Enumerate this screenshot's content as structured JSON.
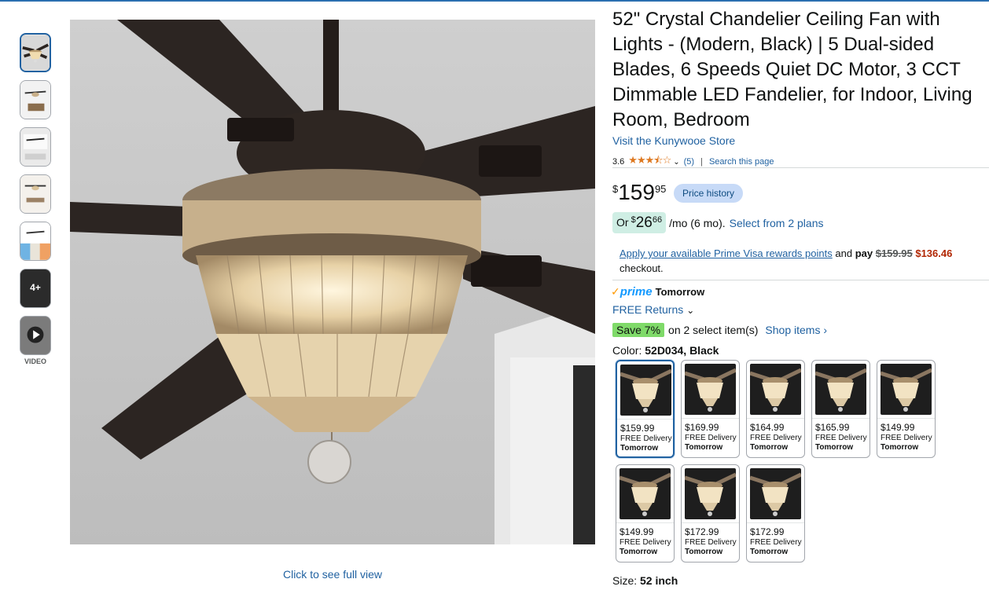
{
  "thumbnails": {
    "more_label": "4+",
    "video_label": "VIDEO"
  },
  "main_image": {
    "caption": "Click to see full view"
  },
  "product": {
    "title": "52\" Crystal Chandelier Ceiling Fan with Lights - (Modern, Black) | 5 Dual-sided Blades, 6 Speeds Quiet DC Motor, 3 CCT Dimmable LED Fandelier, for Indoor, Living Room, Bedroom",
    "store_link": "Visit the Kunywooe Store",
    "rating": "3.6",
    "stars": "★★★⯪☆",
    "review_count": "(5)",
    "search_page": "Search this page"
  },
  "price": {
    "symbol": "$",
    "whole": "159",
    "fraction": "95",
    "history_label": "Price history"
  },
  "monthly": {
    "prefix": "Or",
    "symbol": "$",
    "whole": "26",
    "fraction": "66",
    "suffix": "/mo (6 mo).",
    "plans_link": "Select from 2 plans"
  },
  "visa": {
    "link": "Apply your available Prime Visa rewards points",
    "mid": "and",
    "pay": "pay",
    "old_price": "$159.95",
    "new_price": "$136.46",
    "line2": "checkout."
  },
  "delivery": {
    "prime_label": "prime",
    "day": "Tomorrow",
    "returns": "FREE Returns"
  },
  "promo": {
    "badge": "Save 7%",
    "text": "on 2 select item(s)",
    "shop_link": "Shop items ›"
  },
  "color": {
    "label": "Color:",
    "selected": "52D034, Black"
  },
  "swatches": [
    {
      "price": "$159.99",
      "delivery": "FREE Delivery",
      "day": "Tomorrow"
    },
    {
      "price": "$169.99",
      "delivery": "FREE Delivery",
      "day": "Tomorrow"
    },
    {
      "price": "$164.99",
      "delivery": "FREE Delivery",
      "day": "Tomorrow"
    },
    {
      "price": "$165.99",
      "delivery": "FREE Delivery",
      "day": "Tomorrow"
    },
    {
      "price": "$149.99",
      "delivery": "FREE Delivery",
      "day": "Tomorrow"
    },
    {
      "price": "$149.99",
      "delivery": "FREE Delivery",
      "day": "Tomorrow"
    },
    {
      "price": "$172.99",
      "delivery": "FREE Delivery",
      "day": "Tomorrow"
    },
    {
      "price": "$172.99",
      "delivery": "FREE Delivery",
      "day": "Tomorrow"
    }
  ],
  "size": {
    "label": "Size:",
    "value": "52 inch"
  },
  "colors": {
    "link": "#2162a1",
    "accent_border": "#2162a1",
    "save_badge": "#7fda69",
    "price_red": "#b12704",
    "star": "#de7921"
  }
}
